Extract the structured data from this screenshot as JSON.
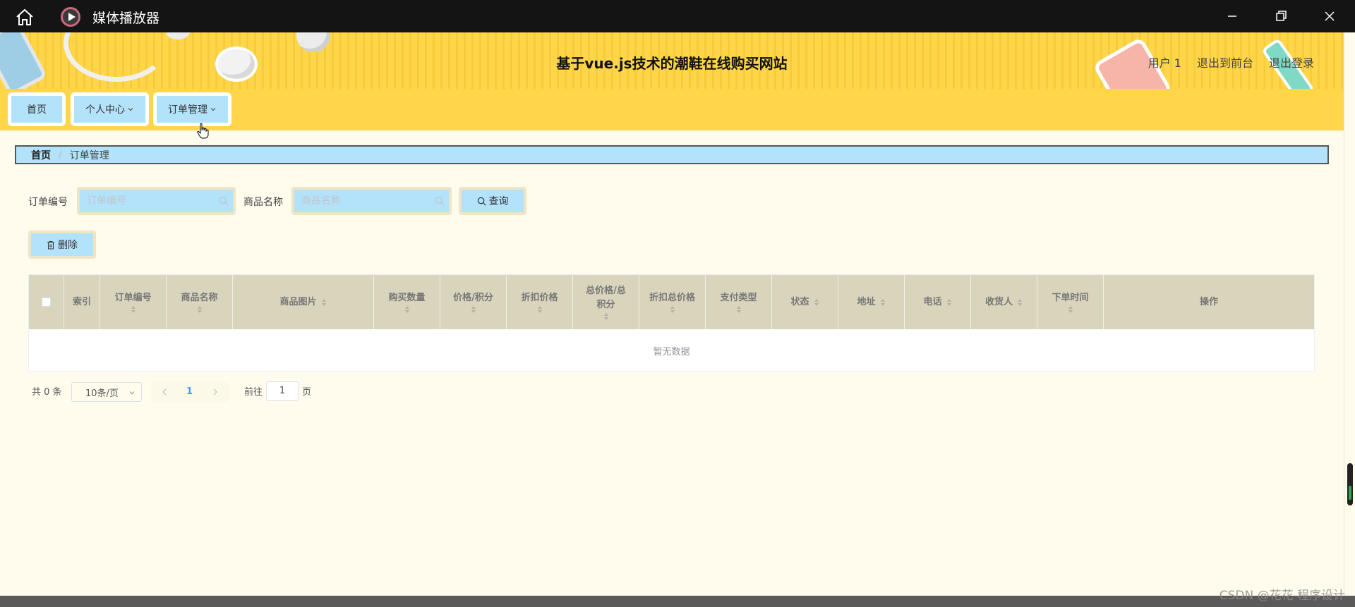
{
  "window": {
    "title": "媒体播放器"
  },
  "header": {
    "site_title": "基于vue.js技术的潮鞋在线购买网站",
    "user": "用户 1",
    "back_to_front": "退出到前台",
    "logout": "退出登录"
  },
  "nav": {
    "items": [
      {
        "label": "首页",
        "has_dropdown": false
      },
      {
        "label": "个人中心",
        "has_dropdown": true
      },
      {
        "label": "订单管理",
        "has_dropdown": true
      }
    ]
  },
  "breadcrumb": {
    "home": "首页",
    "separator": "/",
    "current": "订单管理"
  },
  "search": {
    "order_no_label": "订单编号",
    "order_no_placeholder": "订单编号",
    "order_no_value": "",
    "product_name_label": "商品名称",
    "product_name_placeholder": "商品名称",
    "product_name_value": "",
    "query_button": "查询"
  },
  "actions": {
    "delete_button": "删除"
  },
  "table": {
    "columns": [
      {
        "label": "索引",
        "sortable": false
      },
      {
        "label": "订单编号",
        "sortable": true
      },
      {
        "label": "商品名称",
        "sortable": true
      },
      {
        "label": "商品图片",
        "sortable": true
      },
      {
        "label": "购买数量",
        "sortable": true
      },
      {
        "label": "价格/积分",
        "sortable": true
      },
      {
        "label": "折扣价格",
        "sortable": true
      },
      {
        "label": "总价格/总积分",
        "sortable": true
      },
      {
        "label": "折扣总价格",
        "sortable": true
      },
      {
        "label": "支付类型",
        "sortable": true
      },
      {
        "label": "状态",
        "sortable": true
      },
      {
        "label": "地址",
        "sortable": true
      },
      {
        "label": "电话",
        "sortable": true
      },
      {
        "label": "收货人",
        "sortable": true
      },
      {
        "label": "下单时间",
        "sortable": true
      },
      {
        "label": "操作",
        "sortable": false
      }
    ],
    "rows": [],
    "empty_text": "暂无数据"
  },
  "pagination": {
    "total_text": "共 0 条",
    "page_size": "10条/页",
    "current_page": "1",
    "goto_label": "前往",
    "goto_value": "1",
    "page_suffix": "页"
  },
  "watermark": "CSDN @花花 程序设计",
  "colors": {
    "header_yellow": "#ffd64a",
    "accent_blue": "#b3e3fa",
    "page_bg": "#fffcee",
    "table_header": "#d9d4bc"
  }
}
